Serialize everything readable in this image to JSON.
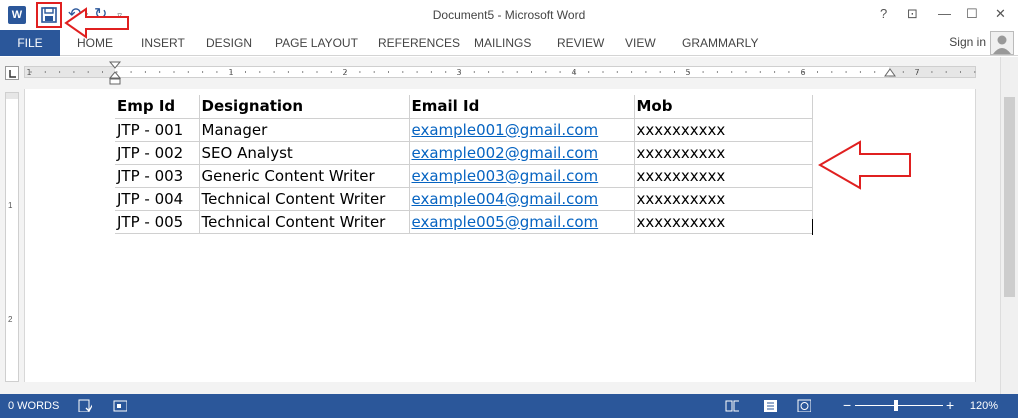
{
  "app": {
    "title": "Document5 - Microsoft Word",
    "logo_letter": "W"
  },
  "window_controls": {
    "help": "?",
    "ribbon_display": "⊡",
    "minimize": "—",
    "maximize": "☐",
    "close": "✕"
  },
  "ribbon": {
    "file": "FILE",
    "tabs": [
      "HOME",
      "INSERT",
      "DESIGN",
      "PAGE LAYOUT",
      "REFERENCES",
      "MAILINGS",
      "REVIEW",
      "VIEW",
      "GRAMMARLY"
    ],
    "sign_in": "Sign in"
  },
  "ruler": {
    "h_numbers": [
      "1",
      "1",
      "2",
      "3",
      "4",
      "5",
      "6",
      "7"
    ],
    "v_numbers": [
      "1",
      "2"
    ]
  },
  "table": {
    "headers": [
      "Emp Id",
      "Designation",
      "Email Id",
      "Mob"
    ],
    "rows": [
      [
        "JTP - 001",
        "Manager",
        "example001@gmail.com",
        "xxxxxxxxxx"
      ],
      [
        "JTP - 002",
        "SEO Analyst",
        "example002@gmail.com",
        "xxxxxxxxxx"
      ],
      [
        "JTP - 003",
        "Generic Content Writer",
        "example003@gmail.com",
        "xxxxxxxxxx"
      ],
      [
        "JTP - 004",
        "Technical Content Writer",
        "example004@gmail.com",
        "xxxxxxxxxx"
      ],
      [
        "JTP - 005",
        "Technical Content Writer",
        "example005@gmail.com",
        "xxxxxxxxxx"
      ]
    ]
  },
  "status": {
    "words": "0 WORDS",
    "zoom": "120%",
    "zoom_minus": "−",
    "zoom_plus": "+"
  },
  "colors": {
    "word_blue": "#2b579a",
    "annotation_red": "#e02020",
    "link_blue": "#0563c1"
  }
}
